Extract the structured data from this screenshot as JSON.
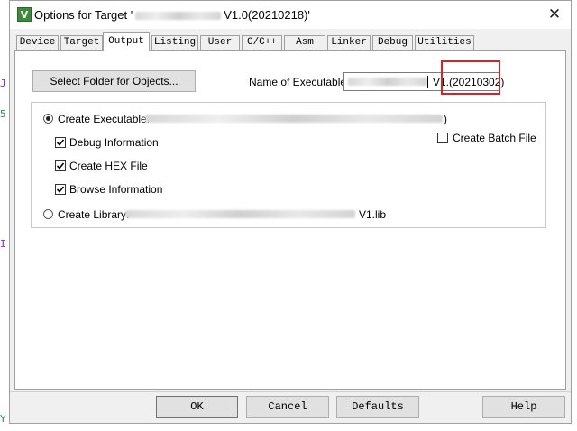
{
  "background": {
    "glyphs": [
      "J",
      "5",
      "I",
      "Y"
    ]
  },
  "window": {
    "title_prefix": "Options for Target '",
    "title_suffix": "V1.0(20210218)'",
    "close_icon": "close-icon"
  },
  "tabs": [
    {
      "label": "Device"
    },
    {
      "label": "Target"
    },
    {
      "label": "Output",
      "active": true
    },
    {
      "label": "Listing"
    },
    {
      "label": "User"
    },
    {
      "label": "C/C++"
    },
    {
      "label": "Asm"
    },
    {
      "label": "Linker"
    },
    {
      "label": "Debug"
    },
    {
      "label": "Utilities"
    }
  ],
  "output": {
    "select_folder_label": "Select Folder for Objects...",
    "name_exe_label": "Name of Executable:",
    "name_exe_value_visible": "V1.",
    "name_exe_value_highlighted": "(20210302)",
    "create_exe_label": "Create Executable:",
    "create_exe_value_tail": ")",
    "debug_info_label": "Debug Information",
    "create_hex_label": "Create HEX File",
    "browse_info_label": "Browse Information",
    "create_batch_label": "Create Batch File",
    "create_library_label": "Create Library:",
    "create_library_value_tail": "V1.lib",
    "create_exe_checked": true,
    "debug_info_checked": true,
    "create_hex_checked": true,
    "browse_info_checked": true,
    "create_batch_checked": false
  },
  "footer": {
    "ok_label": "OK",
    "cancel_label": "Cancel",
    "defaults_label": "Defaults",
    "help_label": "Help"
  },
  "colors": {
    "highlight": "#e02020",
    "dialog_bg": "#f0f0f0",
    "button_bg": "#e1e1e1"
  }
}
